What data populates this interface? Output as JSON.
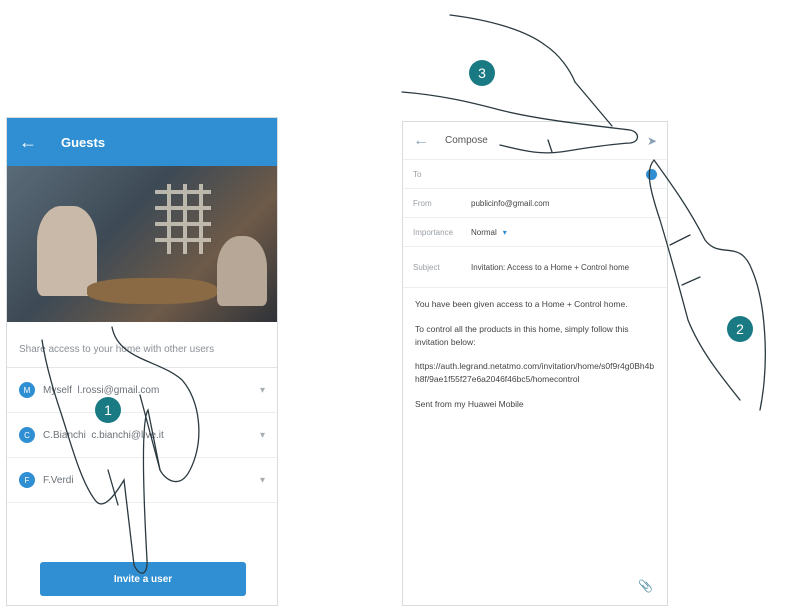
{
  "left_screen": {
    "title": "Guests",
    "back_icon": "arrow-left-icon",
    "share_text": "Share access to your home with other users",
    "users": [
      {
        "initial": "M",
        "name": "Myself",
        "email": "l.rossi@gmail.com"
      },
      {
        "initial": "C",
        "name": "C.Bianchi",
        "email": "c.bianchi@live.it"
      },
      {
        "initial": "F",
        "name": "F.Verdi",
        "email": ""
      }
    ],
    "invite_button": "Invite a user"
  },
  "right_screen": {
    "title": "Compose",
    "to_label": "To",
    "from_label": "From",
    "from_value": "publicinfo@gmail.com",
    "priority_label": "Importance",
    "priority_value": "Normal",
    "subject_label": "Subject",
    "subject_value": "Invitation: Access to a Home + Control home",
    "body": [
      "You have been given access to a Home + Control home.",
      "To control all the products in this home, simply follow this invitation below:",
      "https://auth.legrand.netatmo.com/invitation/home/s0f9r4g0Bh4bh8f/9ae1f55f27e6a2046f46bc5/homecontrol",
      "Sent from my Huawei Mobile"
    ]
  },
  "steps": [
    "1",
    "2",
    "3"
  ]
}
